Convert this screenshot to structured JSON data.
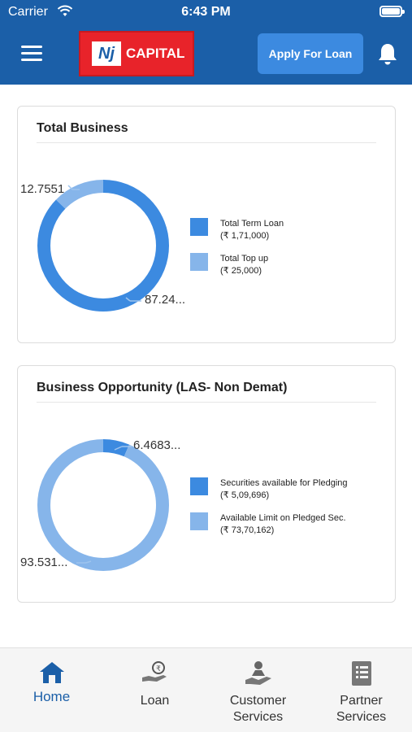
{
  "status_bar": {
    "carrier": "Carrier",
    "time": "6:43 PM"
  },
  "header": {
    "logo_mark": "Nj",
    "logo_text": "CAPITAL",
    "apply_button": "Apply For Loan",
    "colors": {
      "header_bg": "#1b5fa8",
      "logo_bg": "#e8232a",
      "button_bg": "#3c8ae0"
    }
  },
  "cards": [
    {
      "title": "Total Business",
      "chart_data": {
        "type": "pie",
        "donut": true,
        "slices": [
          {
            "label": "Total Term Loan",
            "value": 87.2449,
            "display": "87.24...",
            "color": "#3c8ae0"
          },
          {
            "label": "Total Top up",
            "value": 12.7551,
            "display": "12.7551",
            "color": "#86b5ea"
          }
        ]
      },
      "legend": [
        {
          "label": "Total Term Loan",
          "amount": "(₹ 1,71,000)",
          "color": "#3c8ae0"
        },
        {
          "label": "Total Top up",
          "amount": "(₹ 25,000)",
          "color": "#86b5ea"
        }
      ]
    },
    {
      "title": "Business Opportunity (LAS- Non Demat)",
      "chart_data": {
        "type": "pie",
        "donut": true,
        "slices": [
          {
            "label": "Securities available for Pledging",
            "value": 6.4683,
            "display": "6.4683...",
            "color": "#3c8ae0"
          },
          {
            "label": "Available Limit on Pledged Sec.",
            "value": 93.5317,
            "display": "93.531...",
            "color": "#86b5ea"
          }
        ]
      },
      "legend": [
        {
          "label": "Securities available for Pledging",
          "amount": "(₹ 5,09,696)",
          "color": "#3c8ae0"
        },
        {
          "label": "Available Limit on Pledged Sec.",
          "amount": "(₹ 73,70,162)",
          "color": "#86b5ea"
        }
      ]
    }
  ],
  "tabs": [
    {
      "line1": "Home",
      "line2": "",
      "icon": "home-icon",
      "active": true
    },
    {
      "line1": "Loan",
      "line2": "",
      "icon": "loan-hand-icon",
      "active": false
    },
    {
      "line1": "Customer",
      "line2": "Services",
      "icon": "customer-services-icon",
      "active": false
    },
    {
      "line1": "Partner",
      "line2": "Services",
      "icon": "partner-document-icon",
      "active": false
    }
  ]
}
